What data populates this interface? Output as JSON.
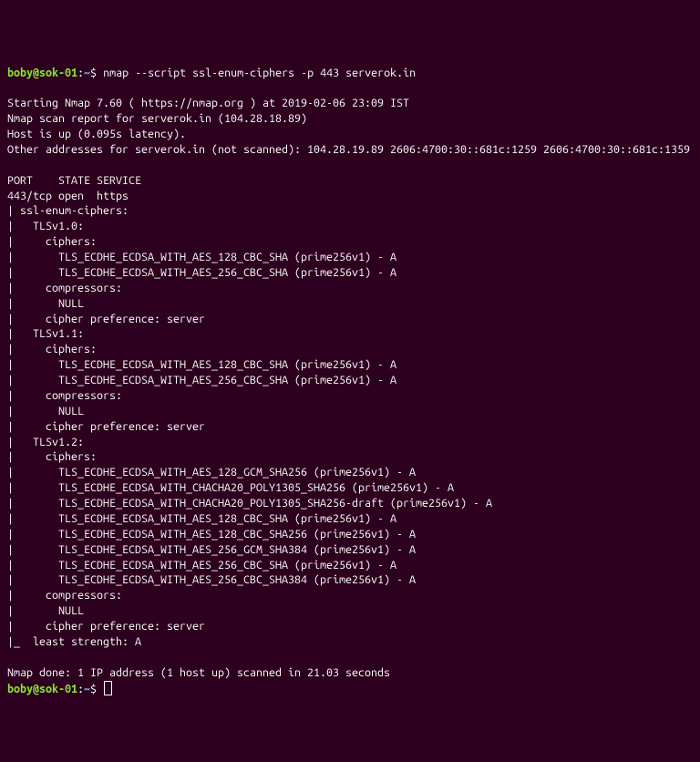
{
  "prompt1": {
    "userhost": "boby@sok-01",
    "colon": ":",
    "path": "~",
    "dollar": "$ ",
    "command": "nmap --script ssl-enum-ciphers -p 443 serverok.in"
  },
  "blank1": " ",
  "start": "Starting Nmap 7.60 ( https://nmap.org ) at 2019-02-06 23:09 IST",
  "scanreport": "Nmap scan report for serverok.in (104.28.18.89)",
  "hostup": "Host is up (0.095s latency).",
  "other": "Other addresses for serverok.in (not scanned): 104.28.19.89 2606:4700:30::681c:1259 2606:4700:30::681c:1359",
  "blank2": " ",
  "header": "PORT    STATE SERVICE",
  "port": "443/tcp open  https",
  "l01": "| ssl-enum-ciphers: ",
  "l02": "|   TLSv1.0: ",
  "l03": "|     ciphers: ",
  "l04": "|       TLS_ECDHE_ECDSA_WITH_AES_128_CBC_SHA (prime256v1) - A",
  "l05": "|       TLS_ECDHE_ECDSA_WITH_AES_256_CBC_SHA (prime256v1) - A",
  "l06": "|     compressors: ",
  "l07": "|       NULL",
  "l08": "|     cipher preference: server",
  "l09": "|   TLSv1.1: ",
  "l10": "|     ciphers: ",
  "l11": "|       TLS_ECDHE_ECDSA_WITH_AES_128_CBC_SHA (prime256v1) - A",
  "l12": "|       TLS_ECDHE_ECDSA_WITH_AES_256_CBC_SHA (prime256v1) - A",
  "l13": "|     compressors: ",
  "l14": "|       NULL",
  "l15": "|     cipher preference: server",
  "l16": "|   TLSv1.2: ",
  "l17": "|     ciphers: ",
  "l18": "|       TLS_ECDHE_ECDSA_WITH_AES_128_GCM_SHA256 (prime256v1) - A",
  "l19": "|       TLS_ECDHE_ECDSA_WITH_CHACHA20_POLY1305_SHA256 (prime256v1) - A",
  "l20": "|       TLS_ECDHE_ECDSA_WITH_CHACHA20_POLY1305_SHA256-draft (prime256v1) - A",
  "l21": "|       TLS_ECDHE_ECDSA_WITH_AES_128_CBC_SHA (prime256v1) - A",
  "l22": "|       TLS_ECDHE_ECDSA_WITH_AES_128_CBC_SHA256 (prime256v1) - A",
  "l23": "|       TLS_ECDHE_ECDSA_WITH_AES_256_GCM_SHA384 (prime256v1) - A",
  "l24": "|       TLS_ECDHE_ECDSA_WITH_AES_256_CBC_SHA (prime256v1) - A",
  "l25": "|       TLS_ECDHE_ECDSA_WITH_AES_256_CBC_SHA384 (prime256v1) - A",
  "l26": "|     compressors: ",
  "l27": "|       NULL",
  "l28": "|     cipher preference: server",
  "l29": "|_  least strength: A",
  "blank3": " ",
  "done": "Nmap done: 1 IP address (1 host up) scanned in 21.03 seconds",
  "prompt2": {
    "userhost": "boby@sok-01",
    "colon": ":",
    "path": "~",
    "dollar": "$ "
  }
}
